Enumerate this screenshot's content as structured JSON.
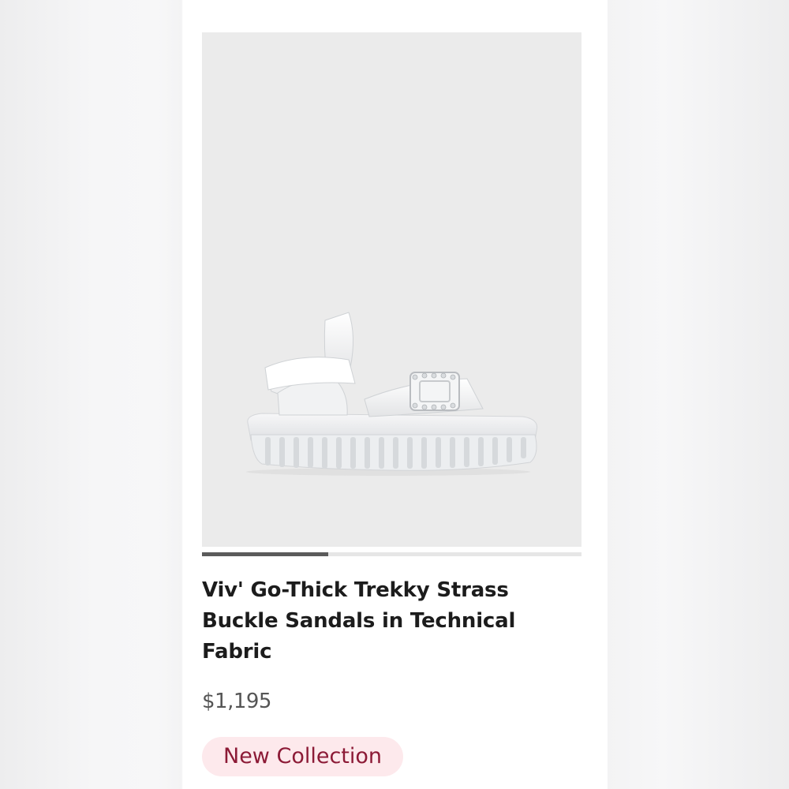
{
  "product": {
    "title": "Viv' Go-Thick Trekky Strass Buckle Sandals in Technical Fabric",
    "price": "$1,195",
    "badge": "New Collection",
    "image_alt": "White platform sandal with jeweled buckle",
    "carousel": {
      "current": 1,
      "total": 3
    }
  },
  "colors": {
    "badge_bg": "#fde9ec",
    "badge_text": "#8c1a36",
    "image_bg": "#ebebeb",
    "indicator": "#5b5b5b"
  }
}
